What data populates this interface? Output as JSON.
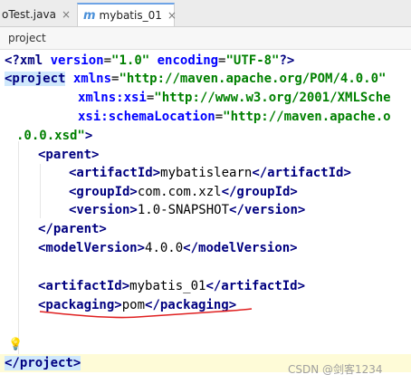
{
  "tabs": [
    {
      "label": "oTest.java",
      "close": "×"
    },
    {
      "icon": "m",
      "label": "mybatis_01",
      "close": "×"
    }
  ],
  "breadcrumb": "project",
  "code": {
    "l1": [
      "<?xml ",
      "version",
      "=",
      "\"1.0\"",
      " encoding",
      "=",
      "\"UTF-8\"",
      "?>"
    ],
    "l2": [
      "<project",
      " xmlns",
      "=",
      "\"http://maven.apache.org/POM/4.0.0\""
    ],
    "l3": [
      "xmlns:xsi",
      "=",
      "\"http://www.w3.org/2001/XMLSche"
    ],
    "l4": [
      "xsi:schemaLocation",
      "=",
      "\"http://maven.apache.o"
    ],
    "l5": [
      ".0.0.xsd\"",
      ">"
    ],
    "l6": [
      "<parent>"
    ],
    "l7": [
      "<artifactId>",
      "mybatislearn",
      "</artifactId>"
    ],
    "l8": [
      "<groupId>",
      "com.com.xzl",
      "</groupId>"
    ],
    "l9": [
      "<version>",
      "1.0-SNAPSHOT",
      "</version>"
    ],
    "l10": [
      "</parent>"
    ],
    "l11": [
      "<modelVersion>",
      "4.0.0",
      "</modelVersion>"
    ],
    "l12": [
      "<artifactId>",
      "mybatis_01",
      "</artifactId>"
    ],
    "l13": [
      "<packaging>",
      "pom",
      "</packaging>"
    ],
    "l14": [
      "</project>"
    ]
  },
  "watermark": "CSDN @剑客1234"
}
